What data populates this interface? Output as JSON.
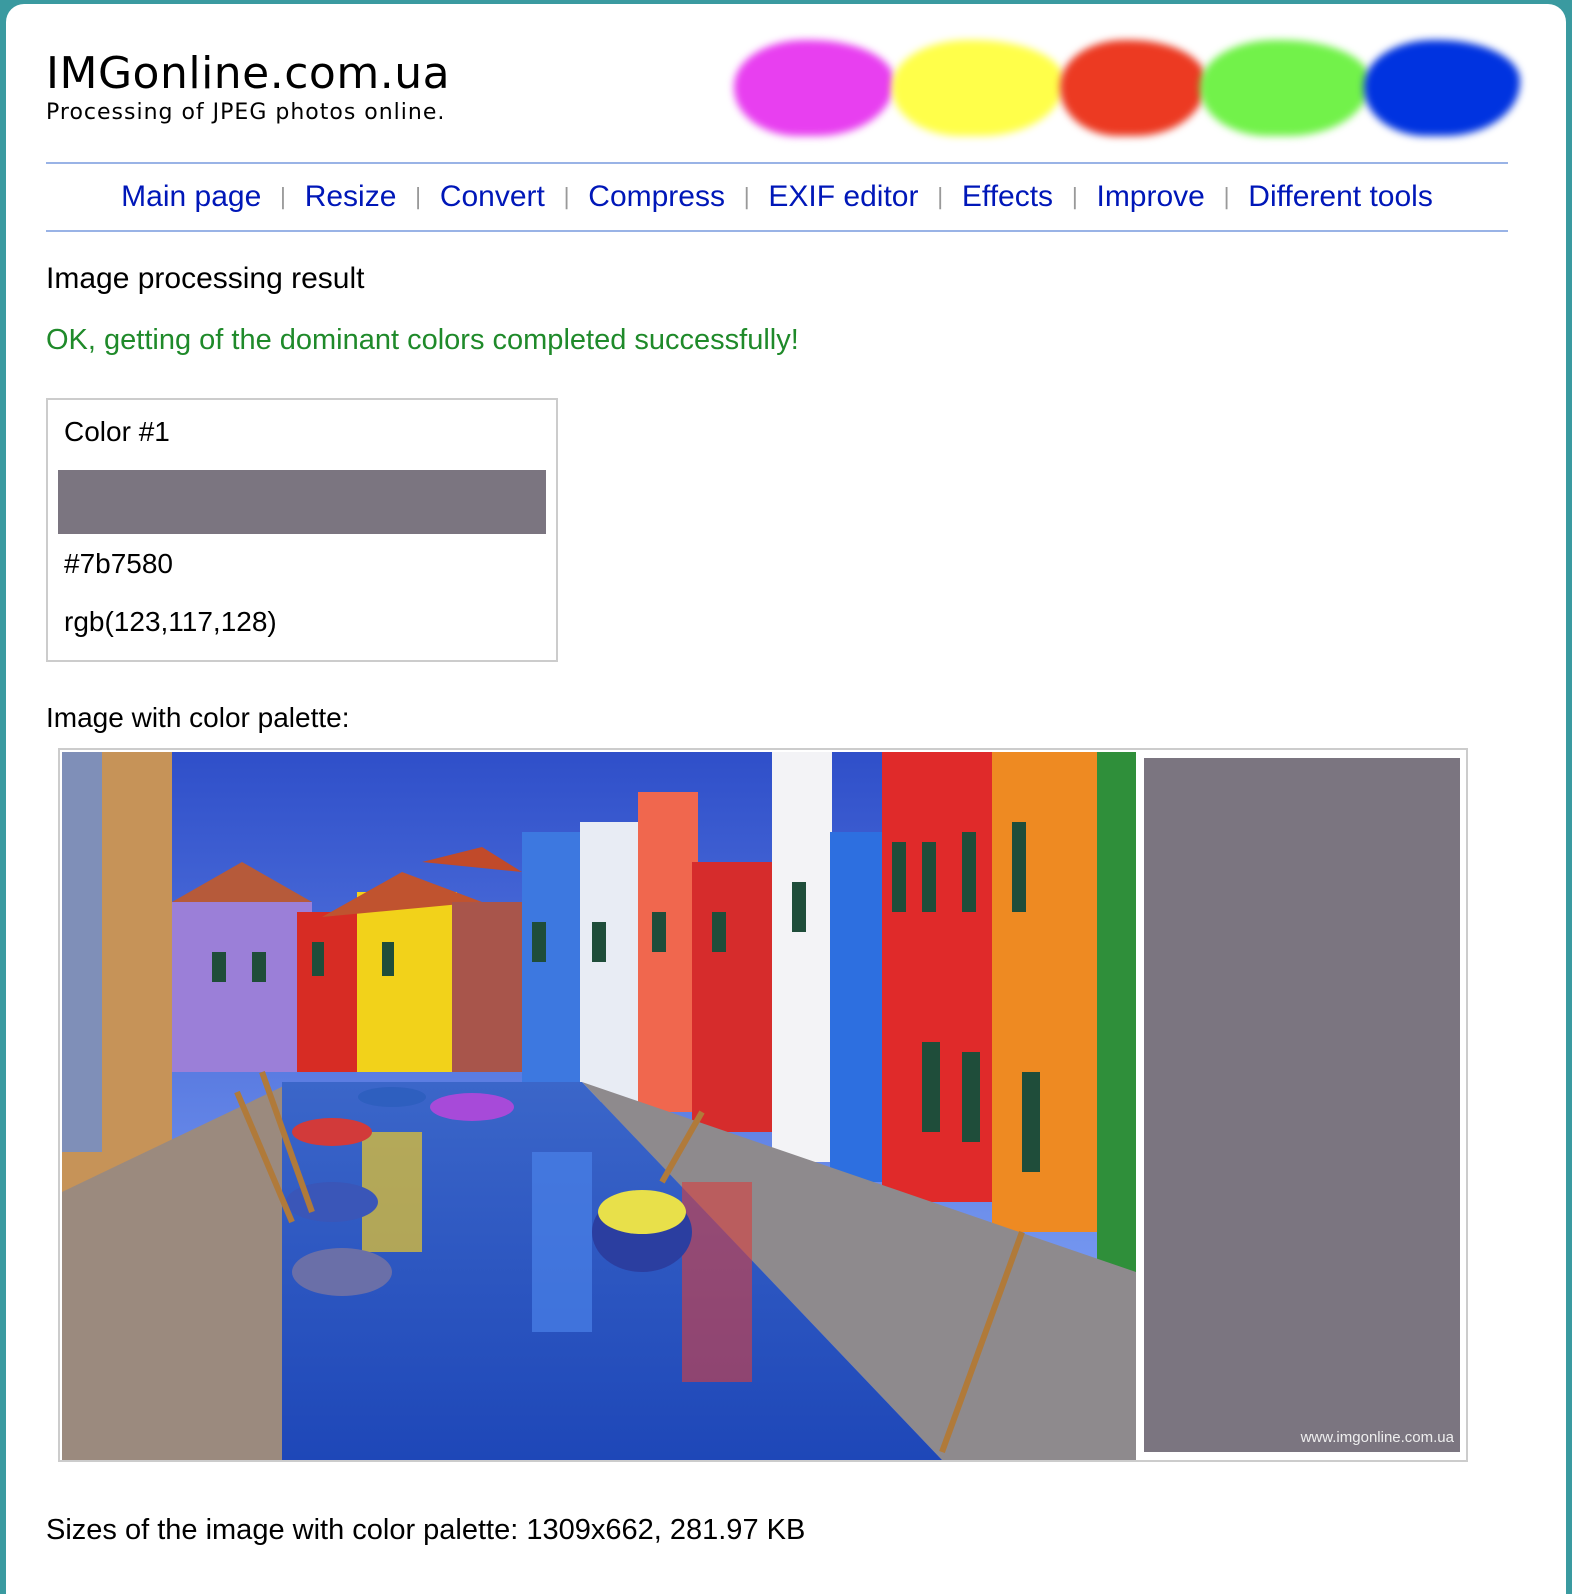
{
  "brand": {
    "title": "IMGonline.com.ua",
    "subtitle": "Processing of JPEG photos online.",
    "blob_colors": [
      "#e83ff0",
      "#ffff4a",
      "#ec3a22",
      "#72f24a",
      "#0033e0"
    ]
  },
  "nav": {
    "items": [
      "Main page",
      "Resize",
      "Convert",
      "Compress",
      "EXIF editor",
      "Effects",
      "Improve",
      "Different tools"
    ]
  },
  "result": {
    "heading": "Image processing result",
    "message": "OK, getting of the dominant colors completed successfully!"
  },
  "color1": {
    "label": "Color #1",
    "hex": "#7b7580",
    "rgb": "rgb(123,117,128)"
  },
  "palette": {
    "label": "Image with color palette:",
    "watermark": "www.imgonline.com.ua",
    "image_description": "canal-with-colorful-houses-and-boats"
  },
  "sizes": {
    "text": "Sizes of the image with color palette: 1309x662, 281.97 KB"
  },
  "colors": {
    "link": "#0017b8",
    "success": "#1f8a2a",
    "border": "#99b3e6"
  }
}
